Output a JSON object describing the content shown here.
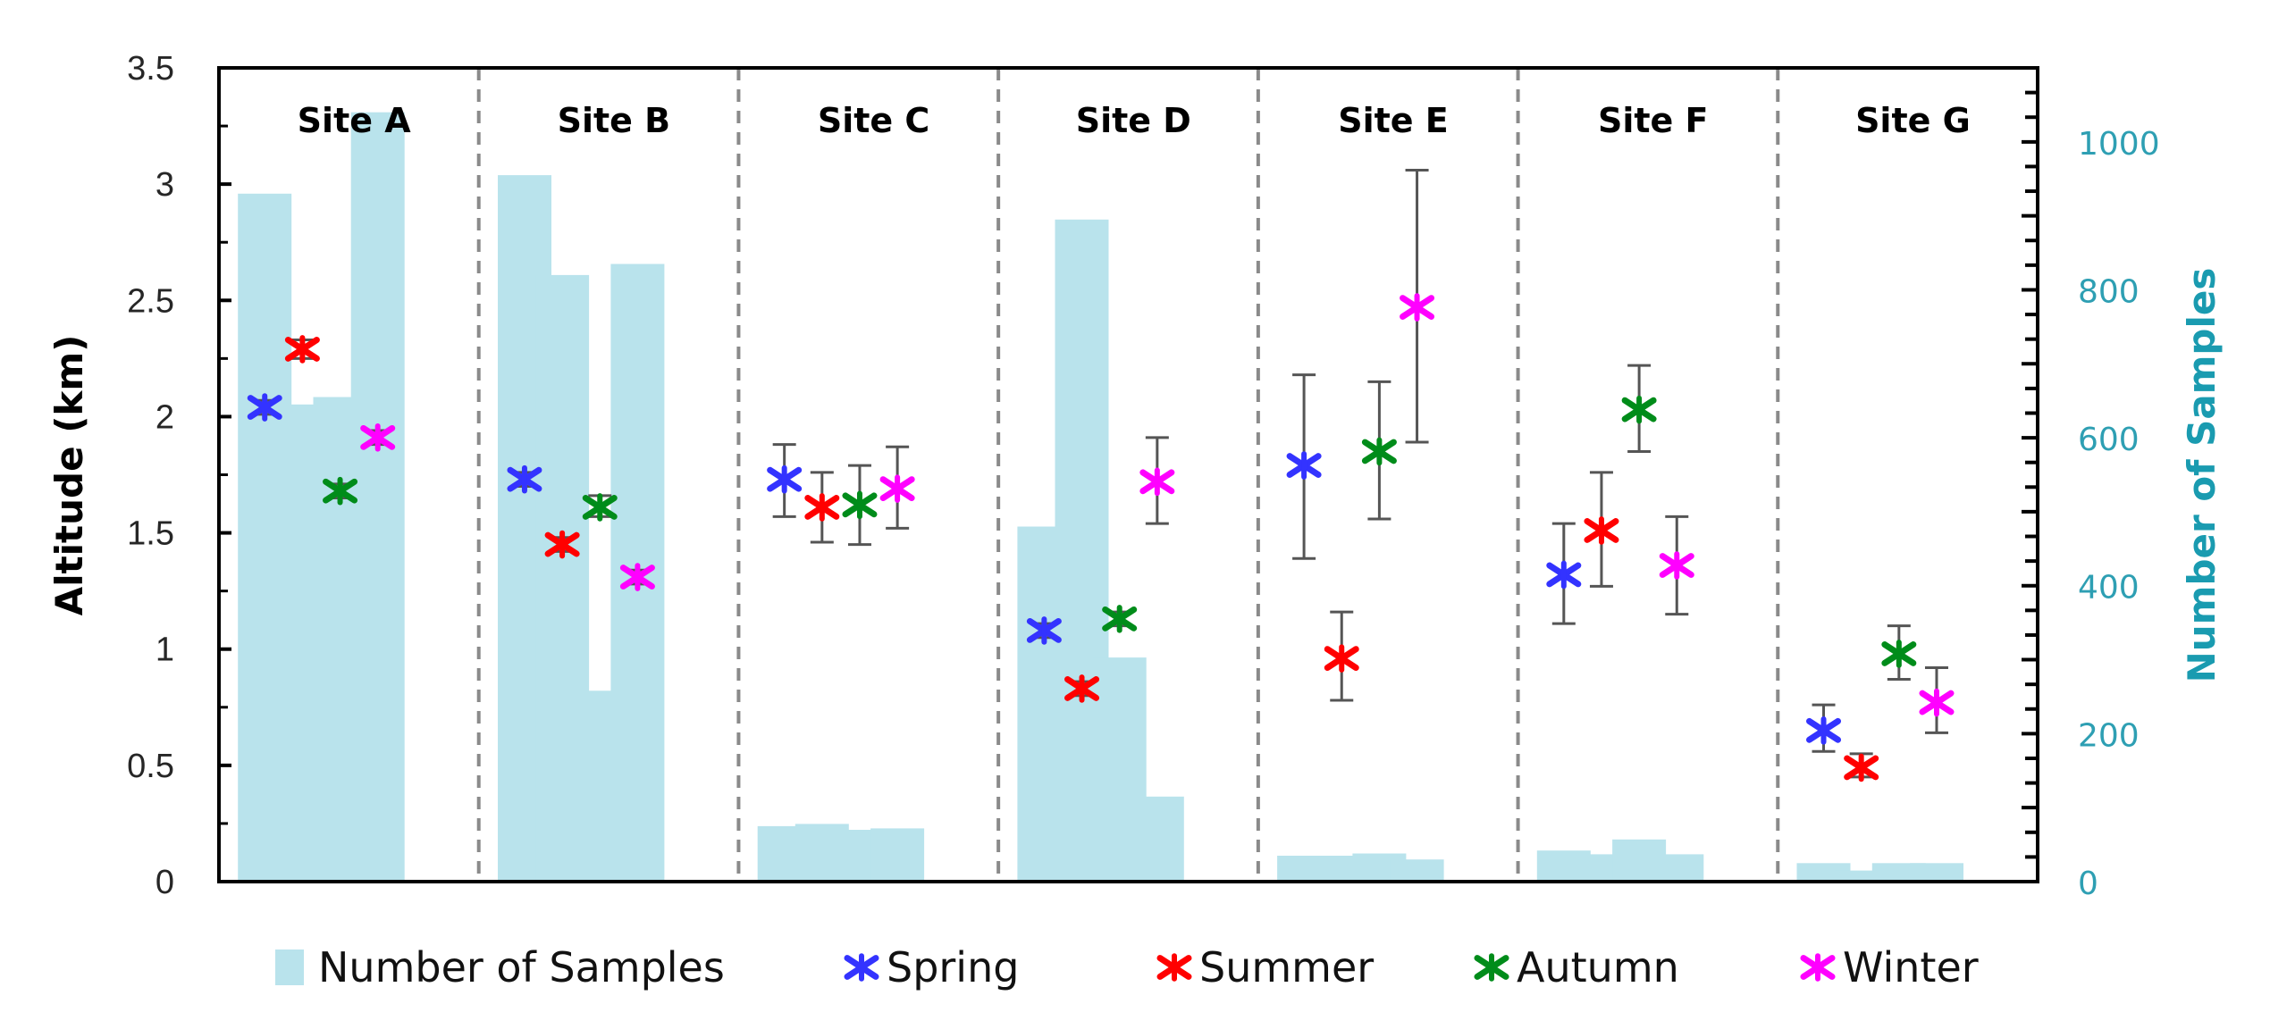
{
  "chart_data": {
    "type": "bar",
    "title": "",
    "categories": [
      "Site A",
      "Site B",
      "Site C",
      "Site D",
      "Site E",
      "Site F",
      "Site G"
    ],
    "seasons": [
      "Spring",
      "Summer",
      "Autumn",
      "Winter"
    ],
    "left_axis": {
      "label": "Altitude (km)",
      "range": [
        0,
        3.5
      ],
      "ticks": [
        "0",
        "0.5",
        "1",
        "1.5",
        "2",
        "2.5",
        "3",
        "3.5"
      ],
      "tick_values": [
        0,
        0.5,
        1,
        1.5,
        2,
        2.5,
        3,
        3.5
      ],
      "minor_step": 0.25
    },
    "right_axis": {
      "label": "Number of Samples",
      "range": [
        0,
        1100
      ],
      "ticks": [
        "0",
        "200",
        "400",
        "600",
        "800",
        "1000"
      ],
      "tick_values": [
        0,
        200,
        400,
        600,
        800,
        1000
      ],
      "minor_step": 66.67,
      "color": "#2a9db2"
    },
    "bars": {
      "name": "Number of Samples",
      "color": "#b9e3ec",
      "values": [
        [
          930,
          645,
          655,
          1040
        ],
        [
          955,
          820,
          258,
          835
        ],
        [
          75,
          78,
          70,
          72
        ],
        [
          480,
          895,
          303,
          115
        ],
        [
          35,
          35,
          38,
          30
        ],
        [
          42,
          37,
          57,
          37
        ],
        [
          25,
          15,
          25,
          25
        ]
      ]
    },
    "series": [
      {
        "name": "Spring",
        "color": "#3333ff",
        "values": [
          2.04,
          1.73,
          1.73,
          1.08,
          1.79,
          1.32,
          0.65
        ],
        "err_low": [
          2.01,
          1.7,
          1.57,
          1.05,
          1.39,
          1.11,
          0.56
        ],
        "err_high": [
          2.07,
          1.76,
          1.88,
          1.11,
          2.18,
          1.54,
          0.76
        ]
      },
      {
        "name": "Summer",
        "color": "#ff0000",
        "values": [
          2.29,
          1.45,
          1.61,
          0.83,
          0.96,
          1.51,
          0.49
        ],
        "err_low": [
          2.25,
          1.42,
          1.46,
          0.8,
          0.78,
          1.27,
          0.45
        ],
        "err_high": [
          2.33,
          1.48,
          1.76,
          0.86,
          1.16,
          1.76,
          0.55
        ]
      },
      {
        "name": "Autumn",
        "color": "#008c1a",
        "values": [
          1.68,
          1.61,
          1.62,
          1.13,
          1.85,
          2.03,
          0.98
        ],
        "err_low": [
          1.65,
          1.57,
          1.45,
          1.1,
          1.56,
          1.85,
          0.87
        ],
        "err_high": [
          1.71,
          1.66,
          1.79,
          1.16,
          2.15,
          2.22,
          1.1
        ]
      },
      {
        "name": "Winter",
        "color": "#ff00ff",
        "values": [
          1.91,
          1.31,
          1.69,
          1.72,
          2.47,
          1.36,
          0.77
        ],
        "err_low": [
          1.88,
          1.28,
          1.52,
          1.54,
          1.89,
          1.15,
          0.64
        ],
        "err_high": [
          1.94,
          1.34,
          1.87,
          1.91,
          3.06,
          1.57,
          0.92
        ]
      }
    ],
    "legend": {
      "position": "bottom",
      "entries": [
        "Number of Samples",
        "Spring",
        "Summer",
        "Autumn",
        "Winter"
      ]
    },
    "grid": false
  }
}
